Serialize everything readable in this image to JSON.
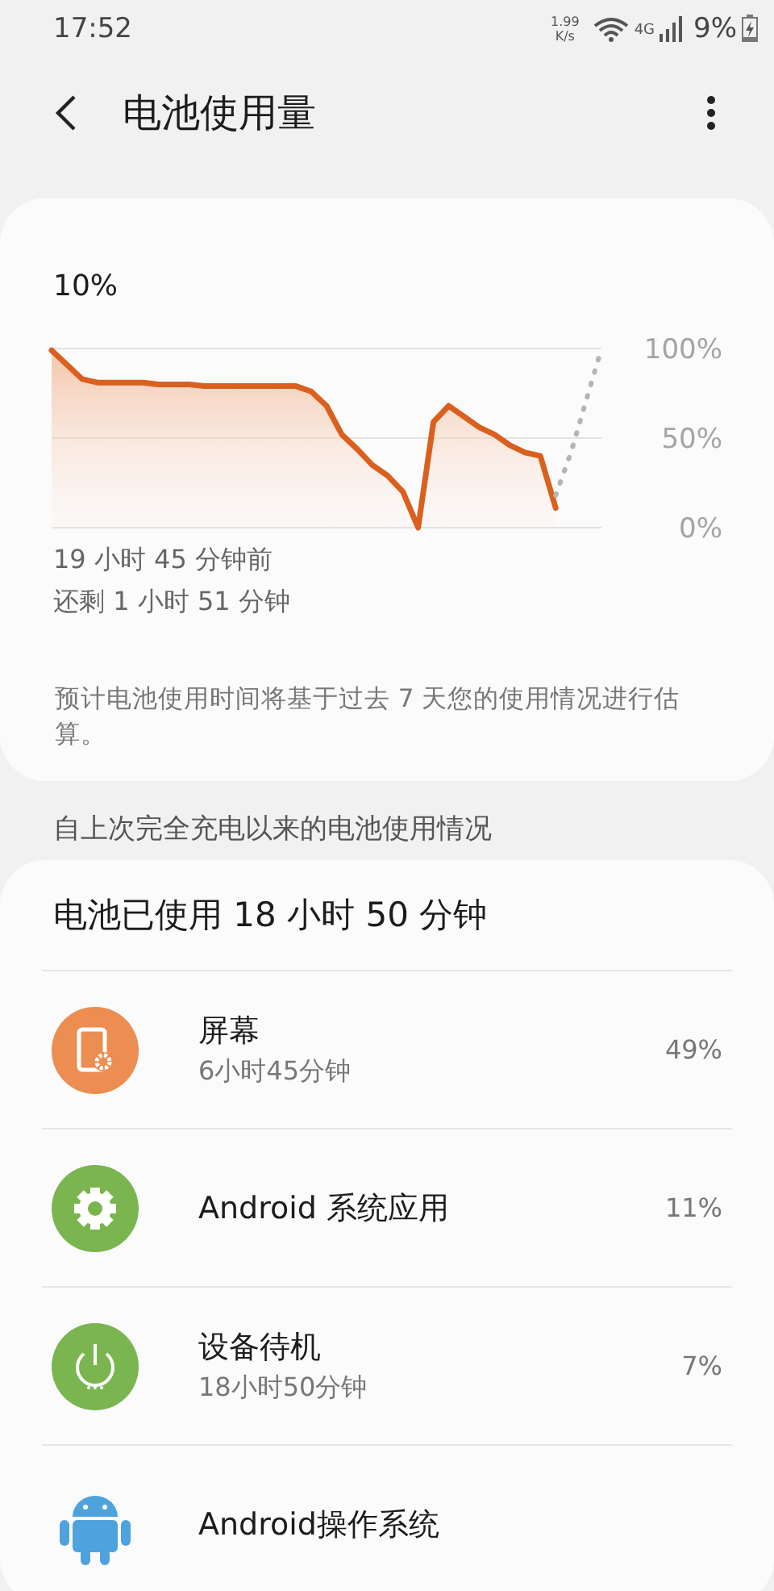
{
  "status_bar": {
    "time": "17:52",
    "speed_value": "1.99",
    "speed_unit": "K/s",
    "network": "4G",
    "battery": "9%",
    "charging": true
  },
  "header": {
    "title": "电池使用量"
  },
  "usage_card": {
    "current": "10%",
    "chart_data": {
      "type": "area",
      "ylim": [
        0,
        100
      ],
      "yticks": [
        {
          "value": 100,
          "label": "100%"
        },
        {
          "value": 50,
          "label": "50%"
        },
        {
          "value": 0,
          "label": "0%"
        }
      ],
      "series": [
        {
          "color": "#d9601e",
          "values": [
            99,
            91,
            83,
            81,
            81,
            81,
            81,
            80,
            80,
            80,
            79,
            79,
            79,
            79,
            79,
            79,
            79,
            76,
            68,
            52,
            44,
            35,
            29,
            20,
            0,
            59,
            68,
            62,
            56,
            52,
            46,
            42,
            40,
            11,
            null,
            null,
            null
          ]
        },
        {
          "color": "#b4b4b4",
          "type": "line",
          "line_style": "dotted",
          "values": [
            null,
            null,
            null,
            null,
            null,
            null,
            null,
            null,
            null,
            null,
            null,
            null,
            null,
            null,
            null,
            null,
            null,
            null,
            null,
            null,
            null,
            null,
            null,
            null,
            null,
            null,
            null,
            null,
            null,
            null,
            null,
            null,
            null,
            18,
            42,
            71,
            100
          ]
        }
      ]
    },
    "since": "19 小时 45 分钟前",
    "remaining": "还剩 1 小时 51 分钟",
    "note": "预计电池使用时间将基于过去 7 天您的使用情况进行估算。"
  },
  "section_title": "自上次完全充电以来的电池使用情况",
  "usage_list": {
    "total": "电池已使用 18 小时 50 分钟",
    "items": [
      {
        "kind": "screen",
        "name": "屏幕",
        "duration": "6小时45分钟",
        "percent": "49%"
      },
      {
        "kind": "system",
        "name": "Android 系统应用",
        "percent": "11%"
      },
      {
        "kind": "standby",
        "name": "设备待机",
        "duration": "18小时50分钟",
        "percent": "7%"
      },
      {
        "kind": "os",
        "name": "Android操作系统"
      }
    ]
  }
}
